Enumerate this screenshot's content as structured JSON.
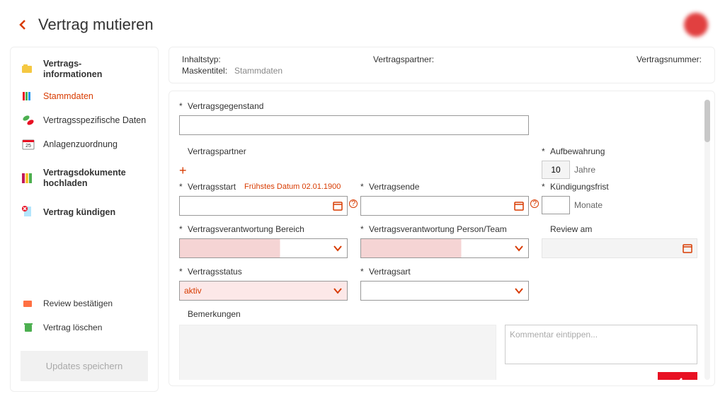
{
  "page": {
    "title": "Vertrag mutieren"
  },
  "sidebar": {
    "items": [
      {
        "label": "Vertrags-\ninformationen"
      },
      {
        "label": "Stammdaten"
      },
      {
        "label": "Vertragsspezifische Daten"
      },
      {
        "label": "Anlagenzuordnung"
      },
      {
        "label": "Vertragsdokumente hochladen"
      },
      {
        "label": "Vertrag kündigen"
      }
    ],
    "footer": [
      {
        "label": "Review bestätigen"
      },
      {
        "label": "Vertrag löschen"
      }
    ],
    "save_label": "Updates speichern"
  },
  "info": {
    "content_type_label": "Inhaltstyp:",
    "content_type_value": "",
    "mask_title_label": "Maskentitel:",
    "mask_title_value": "Stammdaten",
    "partner_label": "Vertragspartner:",
    "partner_value": "",
    "contract_no_label": "Vertragsnummer:",
    "contract_no_value": ""
  },
  "form": {
    "subject_label": "Vertragsgegenstand",
    "subject_value": "",
    "partner_label": "Vertragspartner",
    "partner_value": "",
    "retention_label": "Aufbewahrung",
    "retention_value": "10",
    "retention_unit": "Jahre",
    "start_label": "Vertragsstart",
    "start_hint": "Frühstes Datum 02.01.1900",
    "start_value": "",
    "end_label": "Vertragsende",
    "end_value": "",
    "notice_label": "Kündigungsfrist",
    "notice_value": "",
    "notice_unit": "Monate",
    "resp_area_label": "Vertragsverantwortung Bereich",
    "resp_area_value": "",
    "resp_person_label": "Vertragsverantwortung Person/Team",
    "resp_person_value": "",
    "review_label": "Review am",
    "review_value": "",
    "status_label": "Vertragsstatus",
    "status_value": "aktiv",
    "type_label": "Vertragsart",
    "type_value": "",
    "remarks_label": "Bemerkungen",
    "remarks_value": "",
    "comment_placeholder": "Kommentar eintippen..."
  }
}
